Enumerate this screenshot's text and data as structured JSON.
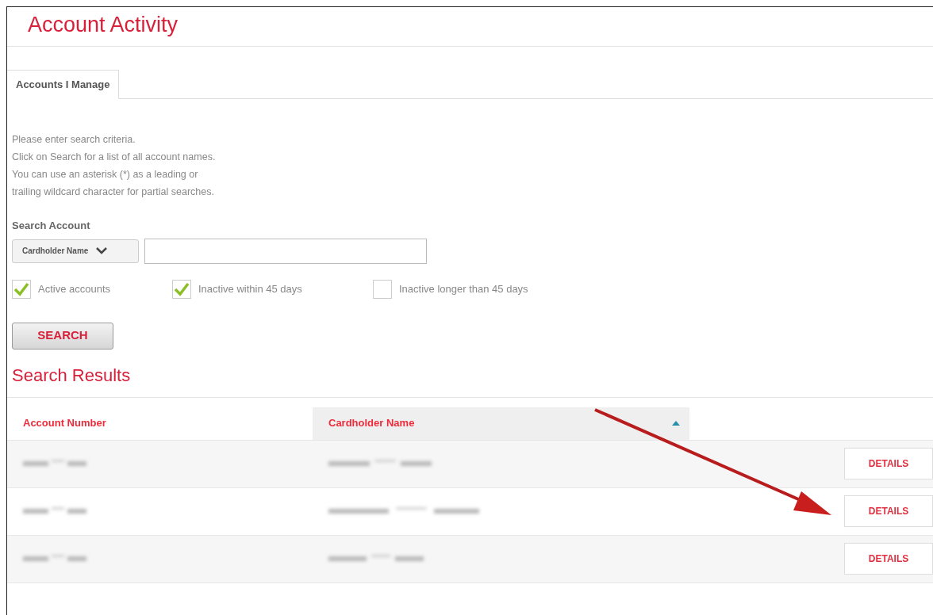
{
  "page": {
    "title": "Account Activity"
  },
  "tabs": [
    {
      "label": "Accounts I Manage",
      "selected": true
    }
  ],
  "instructions": [
    "Please enter search criteria.",
    "Click on Search for a list of all account names.",
    "You can use an asterisk (*) as a leading or",
    "trailing wildcard character for partial searches."
  ],
  "search": {
    "label": "Search Account",
    "field_type": "Cardholder Name",
    "button": "SEARCH"
  },
  "filters": [
    {
      "label": "Active accounts",
      "checked": true
    },
    {
      "label": "Inactive within 45 days",
      "checked": true
    },
    {
      "label": "Inactive longer than 45 days",
      "checked": false
    }
  ],
  "results": {
    "title": "Search Results",
    "columns": [
      {
        "label": "Account Number",
        "sorted": false
      },
      {
        "label": "Cardholder Name",
        "sorted": true
      }
    ],
    "rows": [
      {
        "action": "DETAILS"
      },
      {
        "action": "DETAILS"
      },
      {
        "action": "DETAILS"
      }
    ]
  }
}
